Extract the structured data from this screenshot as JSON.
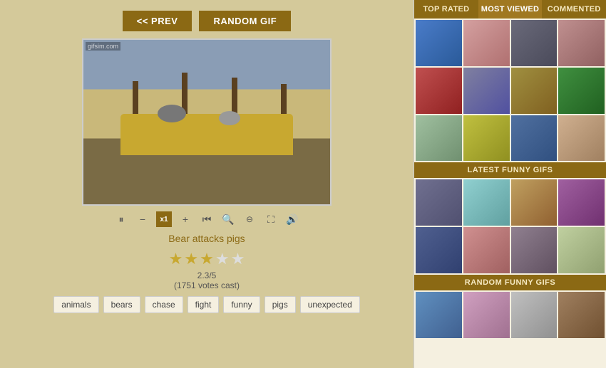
{
  "header": {
    "prev_label": "<< PREV",
    "random_label": "RANDOM GIF"
  },
  "gif": {
    "watermark": "gifsim.com",
    "title": "Bear attacks pigs",
    "rating_value": "2.3/5",
    "votes": "(1751 votes cast)"
  },
  "controls": [
    {
      "id": "pause",
      "symbol": "⏸",
      "label": "pause"
    },
    {
      "id": "minus",
      "symbol": "−",
      "label": "minus"
    },
    {
      "id": "x1",
      "symbol": "x1",
      "label": "speed-x1"
    },
    {
      "id": "plus",
      "symbol": "+",
      "label": "plus"
    },
    {
      "id": "rewind",
      "symbol": "⏮",
      "label": "rewind"
    },
    {
      "id": "zoom-out",
      "symbol": "🔍−",
      "label": "zoom-out"
    },
    {
      "id": "zoom-in",
      "symbol": "🔍+",
      "label": "zoom-in"
    },
    {
      "id": "fullscreen",
      "symbol": "⛶",
      "label": "fullscreen"
    },
    {
      "id": "sound",
      "symbol": "🔊",
      "label": "sound"
    }
  ],
  "stars": [
    1,
    1,
    1,
    0,
    0
  ],
  "tags": [
    {
      "label": "animals",
      "id": "tag-animals"
    },
    {
      "label": "bears",
      "id": "tag-bears"
    },
    {
      "label": "chase",
      "id": "tag-chase"
    },
    {
      "label": "fight",
      "id": "tag-fight"
    },
    {
      "label": "funny",
      "id": "tag-funny"
    },
    {
      "label": "pigs",
      "id": "tag-pigs"
    },
    {
      "label": "unexpected",
      "id": "tag-unexpected"
    }
  ],
  "sidebar": {
    "tabs": [
      {
        "label": "TOP RATED",
        "active": false
      },
      {
        "label": "MOST VIEWED",
        "active": true
      },
      {
        "label": "COMMENTED",
        "active": false
      }
    ],
    "latest_label": "LATEST FUNNY GIFS",
    "random_label": "RANDOM FUNNY GIFS",
    "top_thumbs": [
      "t1",
      "t2",
      "t3",
      "t4",
      "t5",
      "t6",
      "t7",
      "t8",
      "t9",
      "t10",
      "t11",
      "t12"
    ],
    "latest_thumbs": [
      "t13",
      "t14",
      "t15",
      "t16",
      "t17",
      "t18",
      "t19",
      "t20"
    ],
    "random_thumbs": [
      "t21",
      "t22",
      "t23",
      "t24"
    ]
  }
}
